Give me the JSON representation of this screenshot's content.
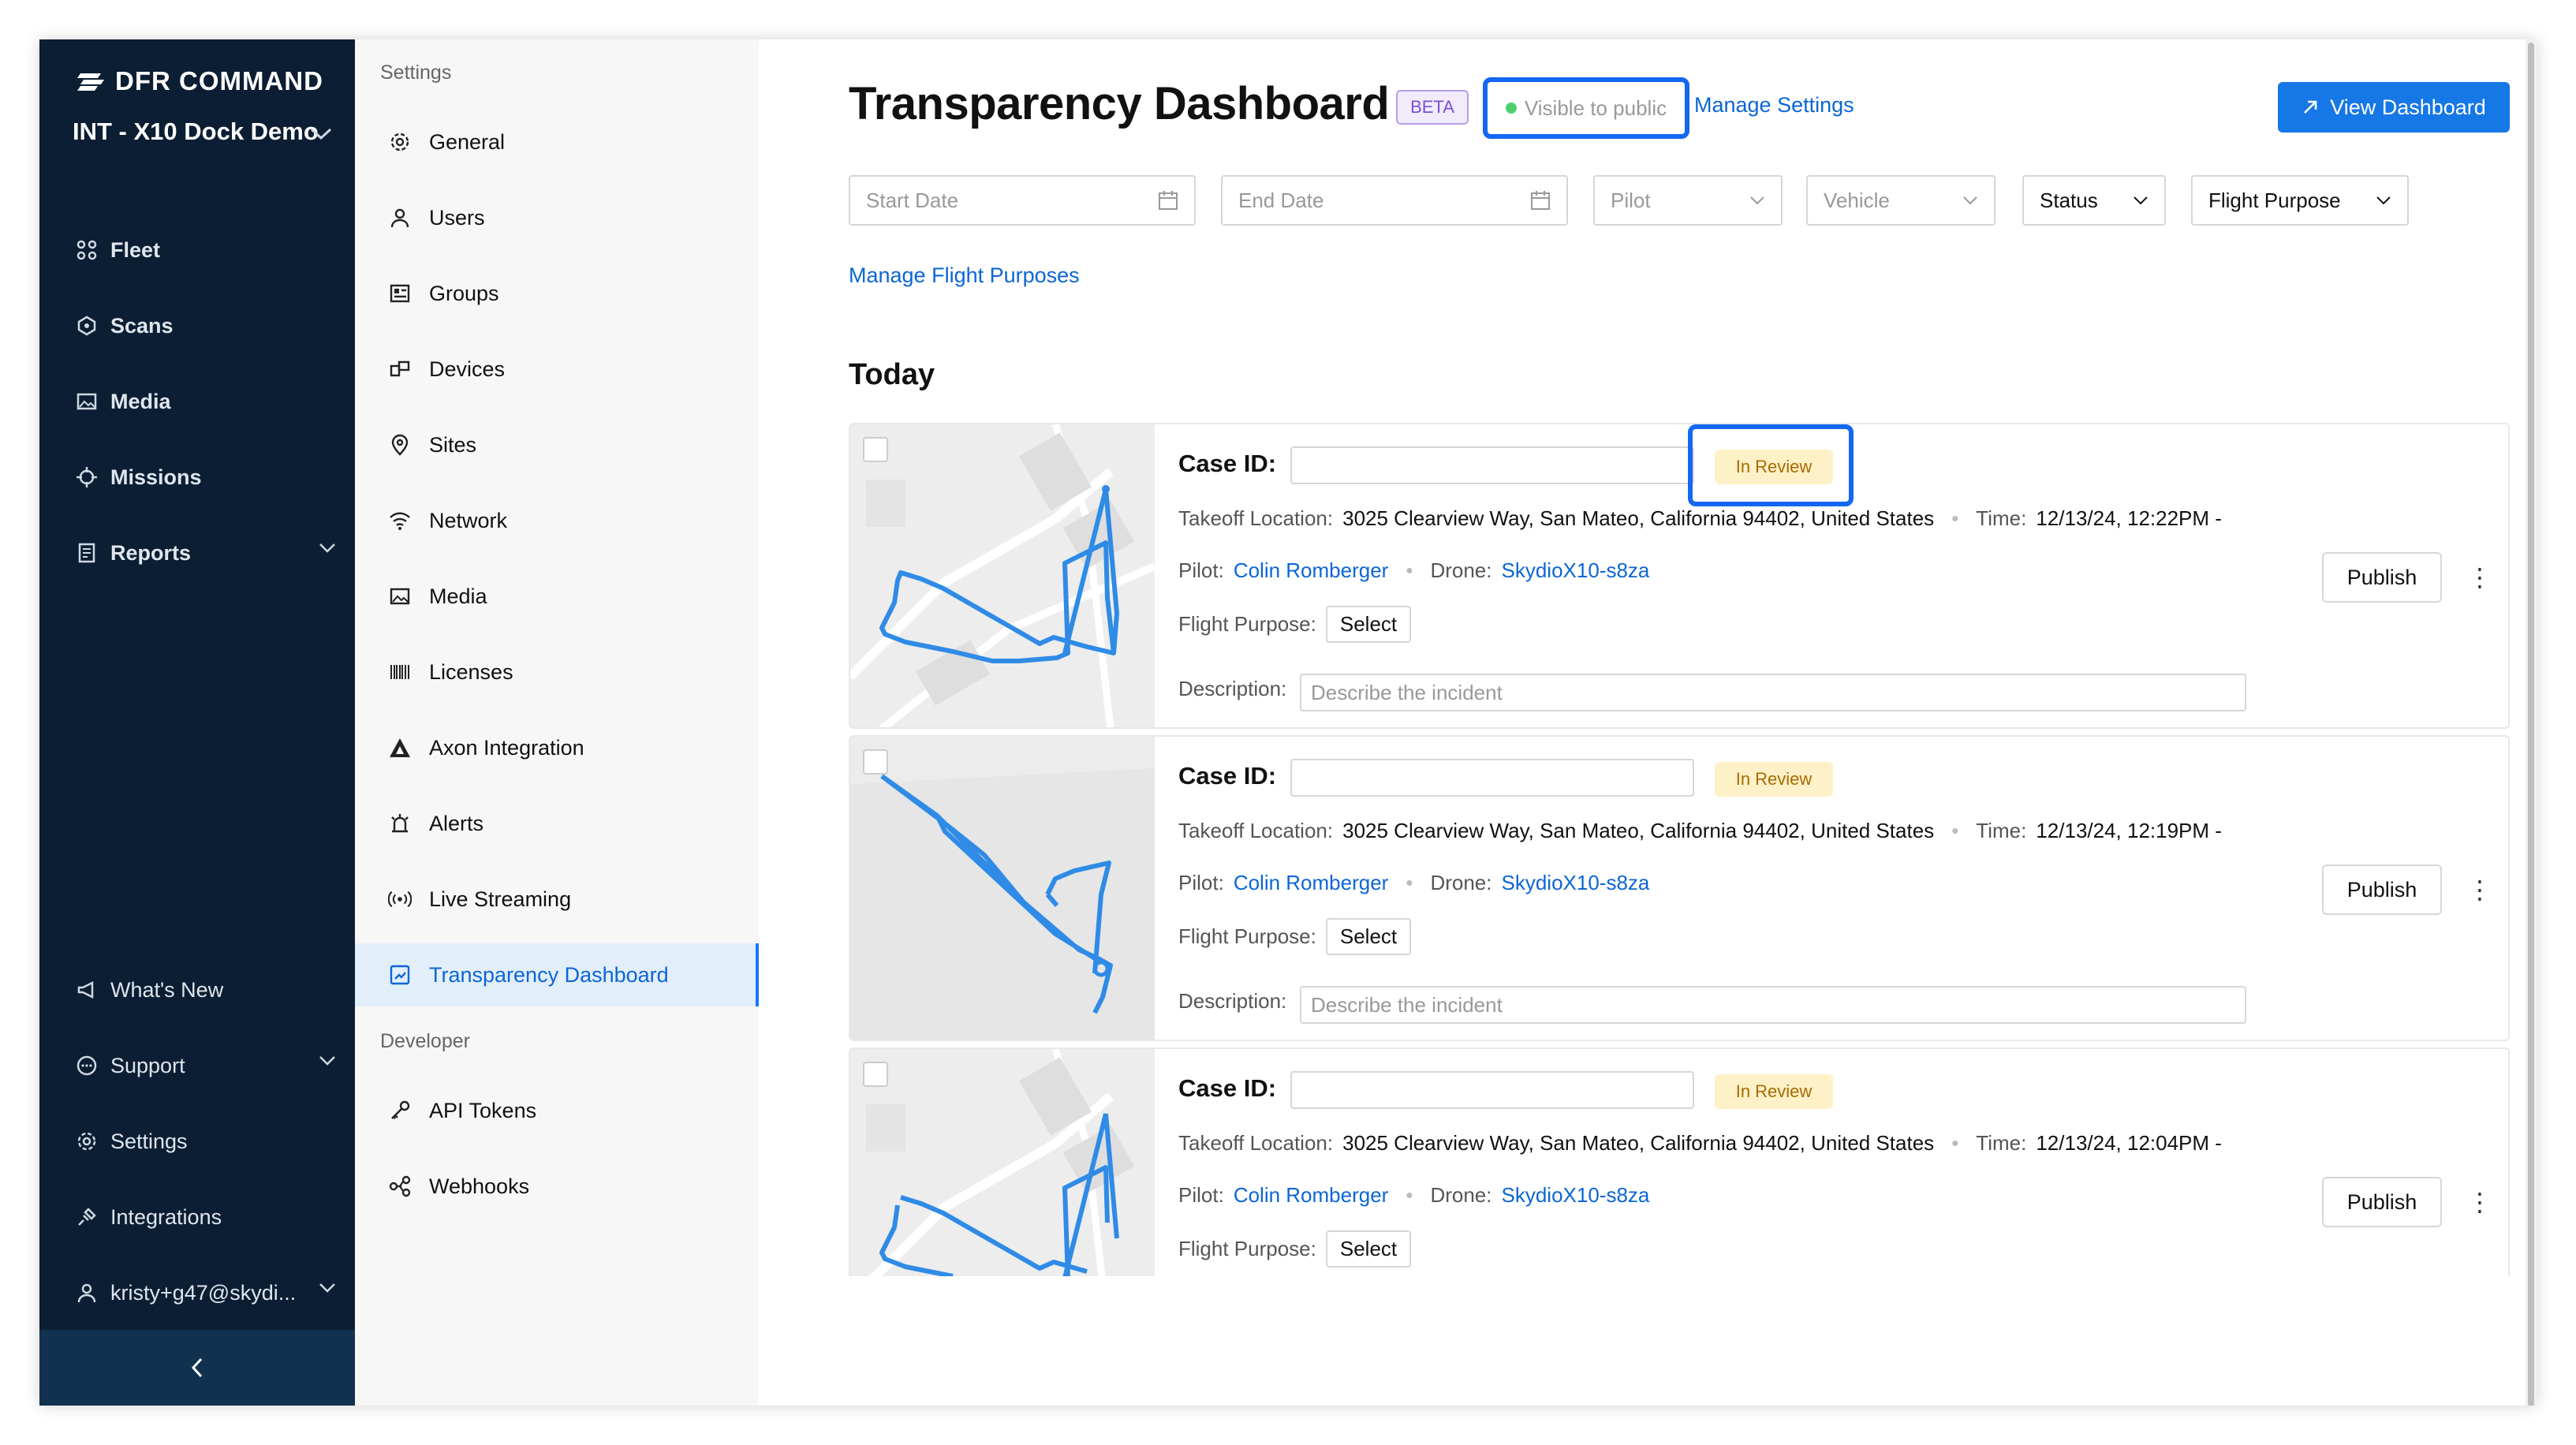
{
  "nav": {
    "brand": "DFR COMMAND",
    "org": "INT - X10 Dock Demo",
    "items": [
      {
        "label": "Fleet",
        "icon": "fleet-icon"
      },
      {
        "label": "Scans",
        "icon": "scans-icon"
      },
      {
        "label": "Media",
        "icon": "media-icon"
      },
      {
        "label": "Missions",
        "icon": "missions-icon"
      },
      {
        "label": "Reports",
        "icon": "reports-icon"
      }
    ],
    "bottom": [
      {
        "label": "What's New",
        "icon": "megaphone-icon"
      },
      {
        "label": "Support",
        "icon": "chat-icon"
      },
      {
        "label": "Settings",
        "icon": "gear-icon"
      },
      {
        "label": "Integrations",
        "icon": "plug-icon"
      },
      {
        "label": "kristy+g47@skydi...",
        "icon": "user-icon"
      }
    ]
  },
  "settings": {
    "section1": "Settings",
    "section2": "Developer",
    "items": [
      "General",
      "Users",
      "Groups",
      "Devices",
      "Sites",
      "Network",
      "Media",
      "Licenses",
      "Axon Integration",
      "Alerts",
      "Live Streaming",
      "Transparency Dashboard"
    ],
    "dev_items": [
      "API Tokens",
      "Webhooks"
    ]
  },
  "main": {
    "title": "Transparency Dashboard",
    "beta": "BETA",
    "visibility": "Visible to public",
    "manage_settings": "Manage Settings",
    "view_dashboard": "View Dashboard",
    "filters": {
      "start_date": "Start Date",
      "end_date": "End Date",
      "pilot": "Pilot",
      "vehicle": "Vehicle",
      "status": "Status",
      "flight_purpose": "Flight Purpose"
    },
    "manage_flight_purposes": "Manage Flight Purposes",
    "section_today": "Today",
    "labels": {
      "case_id": "Case ID:",
      "takeoff": "Takeoff Location:",
      "time": "Time:",
      "pilot": "Pilot:",
      "drone": "Drone:",
      "flight_purpose": "Flight Purpose:",
      "select": "Select",
      "description": "Description:",
      "description_placeholder": "Describe the incident",
      "publish": "Publish"
    },
    "flights": [
      {
        "status": "In Review",
        "location": "3025 Clearview Way, San Mateo, California 94402, United States",
        "time": "12/13/24, 12:22PM -",
        "pilot": "Colin Romberger",
        "drone": "SkydioX10-s8za"
      },
      {
        "status": "In Review",
        "location": "3025 Clearview Way, San Mateo, California 94402, United States",
        "time": "12/13/24, 12:19PM -",
        "pilot": "Colin Romberger",
        "drone": "SkydioX10-s8za"
      },
      {
        "status": "In Review",
        "location": "3025 Clearview Way, San Mateo, California 94402, United States",
        "time": "12/13/24, 12:04PM -",
        "pilot": "Colin Romberger",
        "drone": "SkydioX10-s8za"
      }
    ]
  }
}
